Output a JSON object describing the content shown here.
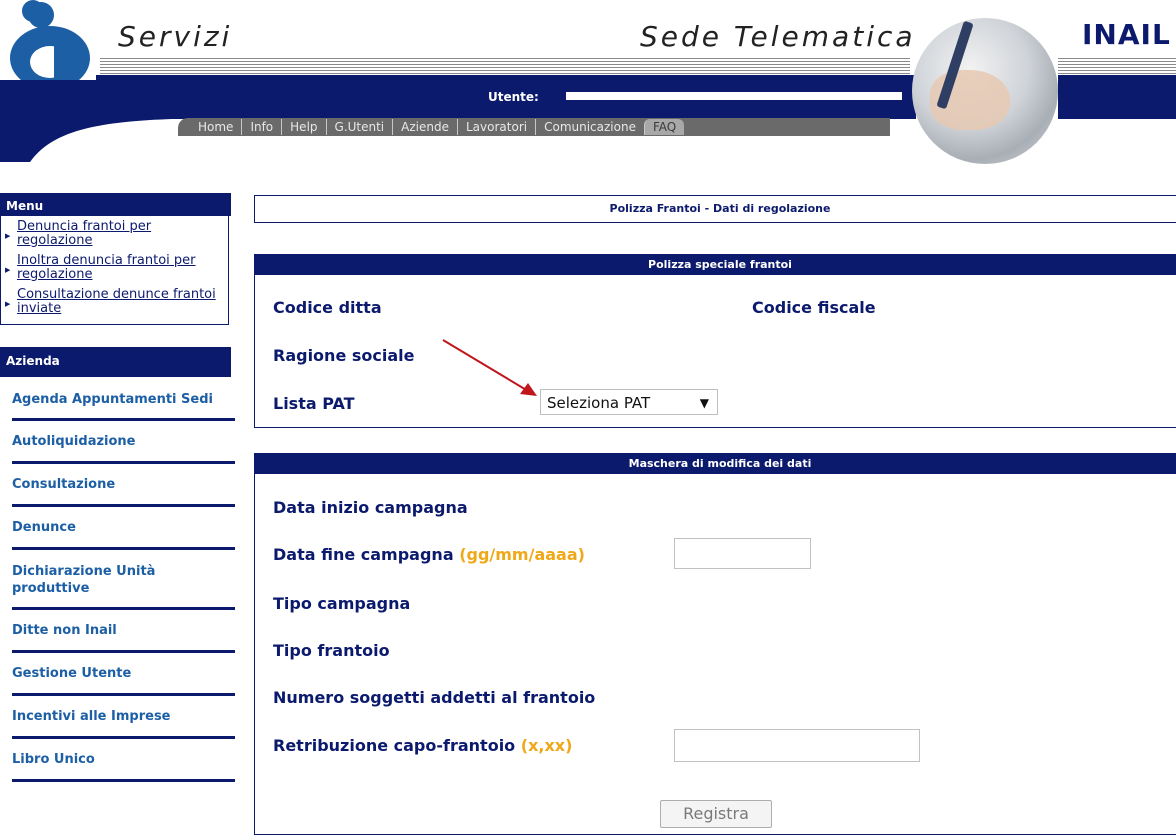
{
  "header": {
    "section_left": "Servizi",
    "section_right": "Sede Telematica",
    "brand": "INAIL",
    "user_label": "Utente:",
    "nav": [
      {
        "label": "Home",
        "active": false
      },
      {
        "label": "Info",
        "active": false
      },
      {
        "label": "Help",
        "active": false
      },
      {
        "label": "G.Utenti",
        "active": false
      },
      {
        "label": "Aziende",
        "active": false
      },
      {
        "label": "Lavoratori",
        "active": false
      },
      {
        "label": "Comunicazione",
        "active": false
      },
      {
        "label": "FAQ",
        "active": true
      }
    ]
  },
  "sidebar": {
    "menu_title": "Menu",
    "menu_links": [
      "Denuncia frantoi per regolazione",
      "Inoltra denuncia frantoi per regolazione",
      "Consultazione denunce frantoi inviate"
    ],
    "azienda_title": "Azienda",
    "items": [
      "Agenda Appuntamenti Sedi",
      "Autoliquidazione",
      "Consultazione",
      "Denunce",
      "Dichiarazione Unità produttive",
      "Ditte non Inail",
      "Gestione Utente",
      "Incentivi alle Imprese",
      "Libro Unico"
    ]
  },
  "main": {
    "page_title": "Polizza Frantoi - Dati di regolazione",
    "polizza": {
      "heading": "Polizza speciale frantoi",
      "codice_ditta": "Codice ditta",
      "codice_fiscale": "Codice fiscale",
      "ragione_sociale": "Ragione sociale",
      "lista_pat": "Lista PAT",
      "pat_selected": "Seleziona PAT"
    },
    "maschera": {
      "heading": "Maschera di modifica dei dati",
      "data_inizio": "Data inizio campagna",
      "data_fine": "Data fine campagna",
      "data_fine_hint": "(gg/mm/aaaa)",
      "data_fine_value": "",
      "tipo_campagna": "Tipo campagna",
      "tipo_frantoio": "Tipo frantoio",
      "numero_soggetti": "Numero soggetti addetti al frantoio",
      "retribuzione": "Retribuzione capo-frantoio",
      "retribuzione_hint": "(x,xx)",
      "retribuzione_value": "",
      "submit": "Registra"
    }
  },
  "colors": {
    "navy": "#0c1a6d",
    "link_blue": "#1d5fa5",
    "hint_orange": "#f0a818",
    "arrow_red": "#c0161c"
  }
}
